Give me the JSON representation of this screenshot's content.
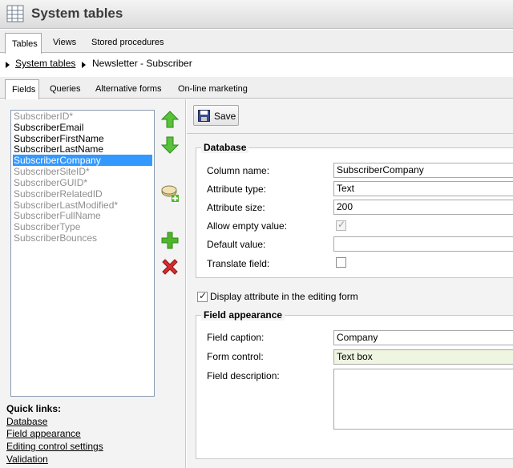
{
  "header": {
    "title": "System tables"
  },
  "top_tabs": [
    {
      "label": "Tables",
      "active": true
    },
    {
      "label": "Views",
      "active": false
    },
    {
      "label": "Stored procedures",
      "active": false
    }
  ],
  "breadcrumb": {
    "parent": "System tables",
    "current": "Newsletter - Subscriber"
  },
  "sub_tabs": [
    {
      "label": "Fields",
      "active": true
    },
    {
      "label": "Queries",
      "active": false
    },
    {
      "label": "Alternative forms",
      "active": false
    },
    {
      "label": "On-line marketing",
      "active": false
    }
  ],
  "fields": [
    {
      "name": "SubscriberID*",
      "kind": "system"
    },
    {
      "name": "SubscriberEmail",
      "kind": "user"
    },
    {
      "name": "SubscriberFirstName",
      "kind": "user"
    },
    {
      "name": "SubscriberLastName",
      "kind": "user"
    },
    {
      "name": "SubscriberCompany",
      "kind": "selected"
    },
    {
      "name": "SubscriberSiteID*",
      "kind": "system"
    },
    {
      "name": "SubscriberGUID*",
      "kind": "system"
    },
    {
      "name": "SubscriberRelatedID",
      "kind": "system"
    },
    {
      "name": "SubscriberLastModified*",
      "kind": "system"
    },
    {
      "name": "SubscriberFullName",
      "kind": "system"
    },
    {
      "name": "SubscriberType",
      "kind": "system"
    },
    {
      "name": "SubscriberBounces",
      "kind": "system"
    }
  ],
  "toolbar_icons": [
    "move-up-icon",
    "move-down-icon",
    "new-category-icon",
    "add-field-icon",
    "delete-field-icon"
  ],
  "quick_links": {
    "title": "Quick links:",
    "items": [
      "Database",
      "Field appearance",
      "Editing control settings",
      "Validation"
    ]
  },
  "save": {
    "label": "Save"
  },
  "database": {
    "title": "Database",
    "column_name": {
      "label": "Column name:",
      "value": "SubscriberCompany"
    },
    "attribute_type": {
      "label": "Attribute type:",
      "value": "Text"
    },
    "attribute_size": {
      "label": "Attribute size:",
      "value": "200"
    },
    "allow_empty": {
      "label": "Allow empty value:",
      "checked": true,
      "disabled": true
    },
    "default_value": {
      "label": "Default value:",
      "value": ""
    },
    "translate_field": {
      "label": "Translate field:",
      "checked": false
    }
  },
  "display_attribute": {
    "label": "Display attribute in the editing form",
    "checked": true
  },
  "field_appearance": {
    "title": "Field appearance",
    "field_caption": {
      "label": "Field caption:",
      "value": "Company"
    },
    "form_control": {
      "label": "Form control:",
      "value": "Text box"
    },
    "field_description": {
      "label": "Field description:",
      "value": ""
    }
  },
  "colors": {
    "selected_bg": "#3399ff",
    "form_control_bg": "#eef5e0",
    "move_green": "#4fb62b",
    "delete_red": "#cc2222"
  }
}
